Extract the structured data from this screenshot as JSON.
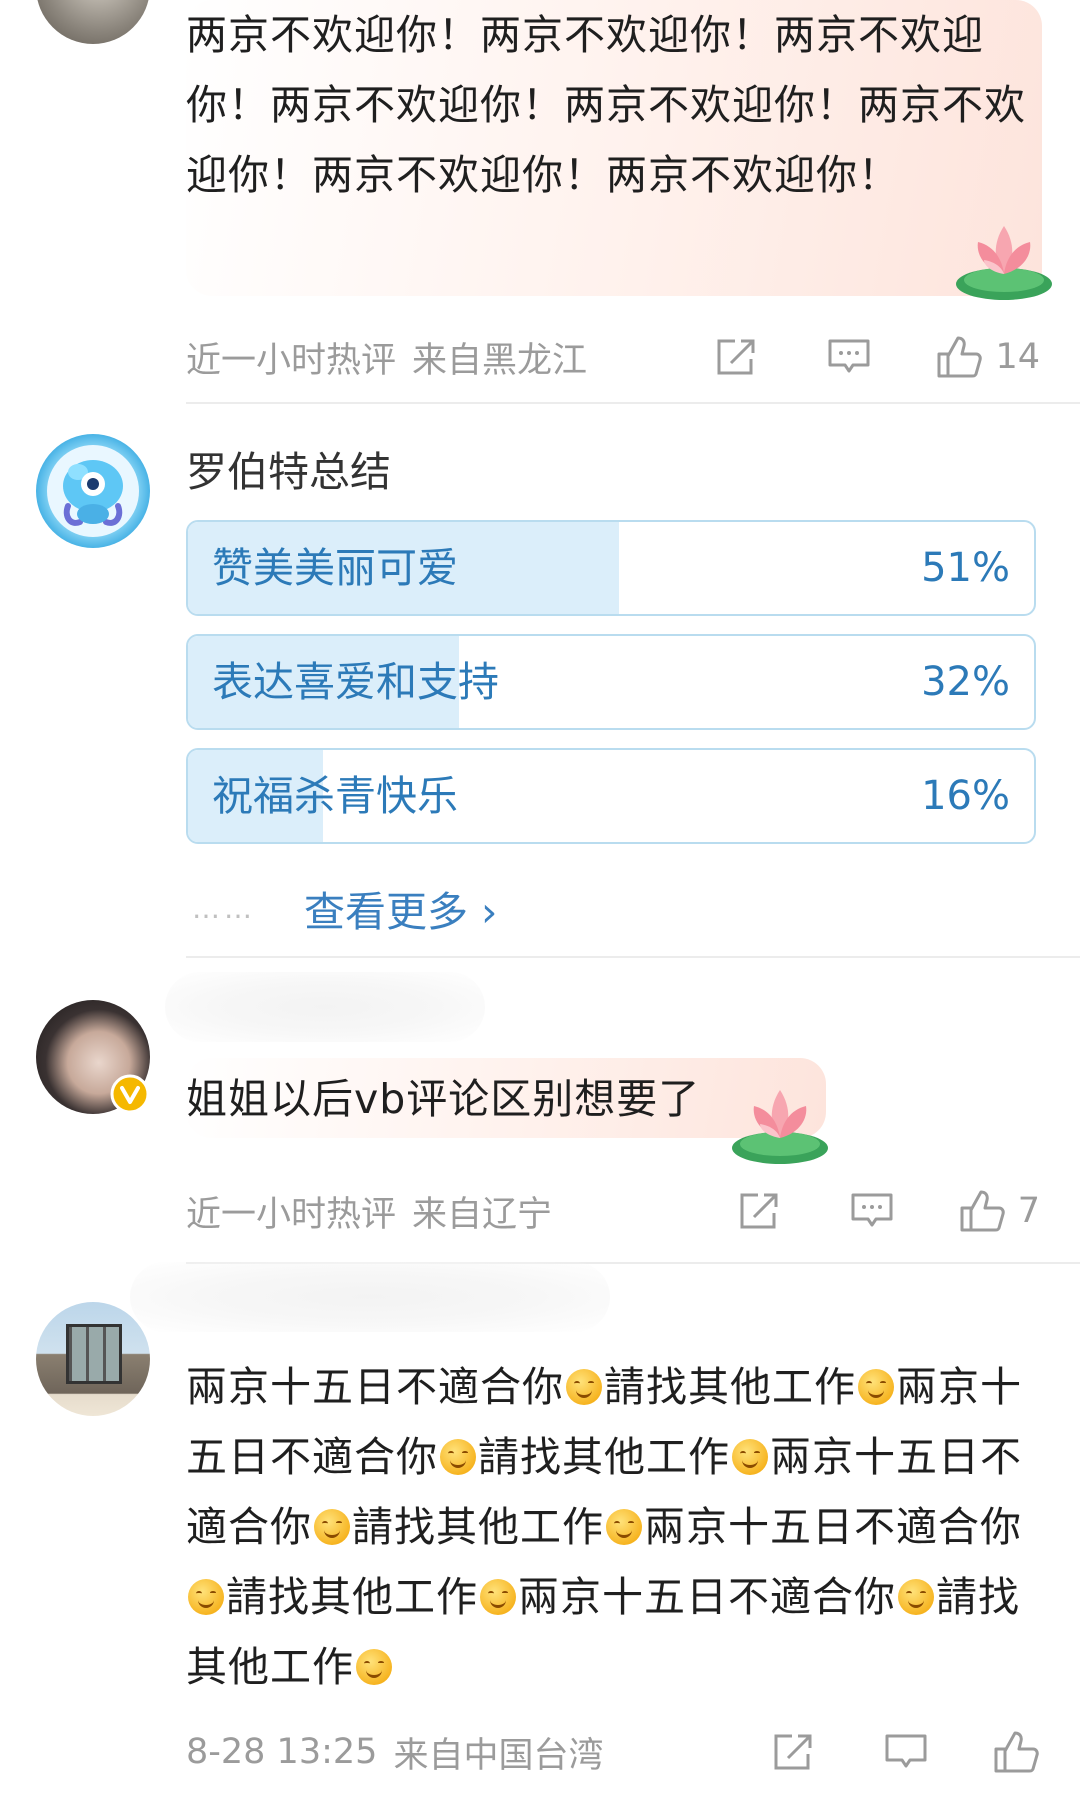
{
  "comments": [
    {
      "text": "两京不欢迎你！两京不欢迎你！两京不欢迎你！两京不欢迎你！两京不欢迎你！两京不欢迎你！两京不欢迎你！两京不欢迎你！",
      "time": "近一小时热评",
      "location": "来自黑龙江",
      "likes": "14"
    },
    {
      "poll_title": "罗伯特总结",
      "options": [
        {
          "label": "赞美美丽可爱",
          "percent": "51%",
          "fraction": 0.51
        },
        {
          "label": "表达喜爱和支持",
          "percent": "32%",
          "fraction": 0.32
        },
        {
          "label": "祝福杀青快乐",
          "percent": "16%",
          "fraction": 0.16
        }
      ],
      "dots": "……",
      "more_label": "查看更多",
      "more_chevron": "›"
    },
    {
      "text": "姐姐以后vb评论区别想要了",
      "time": "近一小时热评",
      "location": "来自辽宁",
      "likes": "7"
    },
    {
      "segments": [
        "兩京十五日不適合你",
        "請找其他工作",
        "兩京十五日不適合你",
        "請找其他工作",
        "兩京十五日不適合你",
        "請找其他工作",
        "兩京十五日不適合你",
        "請找其他工作",
        "兩京十五日不適合你",
        "請找其他工作"
      ],
      "emoji": "smiling-face-emoji",
      "time": "8-28 13:25",
      "location": "来自中国台湾"
    }
  ],
  "icons": {
    "share": "share-icon",
    "comment": "comment-icon",
    "like": "thumbs-up-icon",
    "verified": "verified-badge-icon",
    "decoration": "lotus-icon"
  },
  "colors": {
    "link_blue": "#3a7fbf",
    "poll_text": "#2c7ab8",
    "poll_fill": "#dbeefa",
    "meta_gray": "#9b9b9b",
    "verified_gold": "#f5b800"
  }
}
